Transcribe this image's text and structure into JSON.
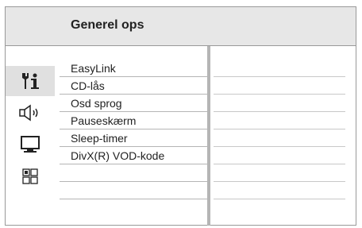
{
  "header": {
    "title": "Generel ops"
  },
  "icons": [
    {
      "name": "settings-tools-icon",
      "active": true
    },
    {
      "name": "speaker-icon",
      "active": false
    },
    {
      "name": "monitor-icon",
      "active": false
    },
    {
      "name": "preferences-grid-icon",
      "active": false
    }
  ],
  "menu": {
    "items": [
      {
        "label": "EasyLink"
      },
      {
        "label": "CD-lås"
      },
      {
        "label": "Osd sprog"
      },
      {
        "label": "Pauseskærm"
      },
      {
        "label": "Sleep-timer"
      },
      {
        "label": "DivX(R) VOD-kode"
      },
      {
        "label": ""
      },
      {
        "label": ""
      }
    ]
  }
}
